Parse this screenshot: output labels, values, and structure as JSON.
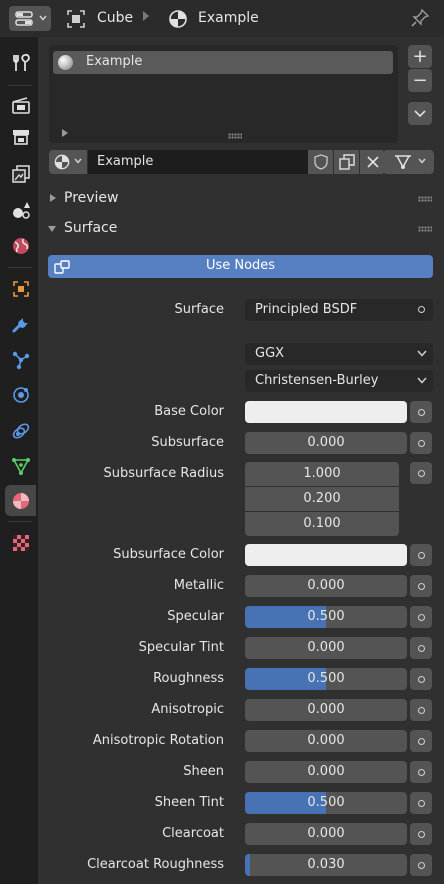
{
  "header": {
    "object_name": "Cube",
    "material_name": "Example"
  },
  "material_slots": [
    {
      "label": "Example",
      "selected": true
    }
  ],
  "material_id": {
    "name": "Example"
  },
  "panels": {
    "preview": "Preview",
    "surface": "Surface"
  },
  "use_nodes_label": "Use Nodes",
  "surface_label": "Surface",
  "surface_shader": "Principled BSDF",
  "distribution": "GGX",
  "subsurface_method": "Christensen-Burley",
  "properties": {
    "base_color": {
      "label": "Base Color",
      "color": "#eeeeee"
    },
    "subsurface": {
      "label": "Subsurface",
      "value": "0.000",
      "fraction": 0.0
    },
    "subsurface_radius": {
      "label": "Subsurface Radius",
      "values": [
        "1.000",
        "0.200",
        "0.100"
      ]
    },
    "subsurface_color": {
      "label": "Subsurface Color",
      "color": "#eeeeee"
    },
    "metallic": {
      "label": "Metallic",
      "value": "0.000",
      "fraction": 0.0
    },
    "specular": {
      "label": "Specular",
      "value": "0.500",
      "fraction": 0.5
    },
    "specular_tint": {
      "label": "Specular Tint",
      "value": "0.000",
      "fraction": 0.0
    },
    "roughness": {
      "label": "Roughness",
      "value": "0.500",
      "fraction": 0.5
    },
    "anisotropic": {
      "label": "Anisotropic",
      "value": "0.000",
      "fraction": 0.0
    },
    "anisotropic_rotation": {
      "label": "Anisotropic Rotation",
      "value": "0.000",
      "fraction": 0.0
    },
    "sheen": {
      "label": "Sheen",
      "value": "0.000",
      "fraction": 0.0
    },
    "sheen_tint": {
      "label": "Sheen Tint",
      "value": "0.500",
      "fraction": 0.5
    },
    "clearcoat": {
      "label": "Clearcoat",
      "value": "0.000",
      "fraction": 0.0
    },
    "clearcoat_roughness": {
      "label": "Clearcoat Roughness",
      "value": "0.030",
      "fraction": 0.03
    }
  },
  "colors": {
    "accent": "#4772b3",
    "use_nodes": "#5680c2",
    "panel_bg": "#303030"
  },
  "icons": {
    "tabs": [
      "tool-icon",
      "render-icon",
      "output-icon",
      "view-layer-icon",
      "scene-icon",
      "world-icon",
      "object-icon",
      "modifier-icon",
      "particles-icon",
      "physics-icon",
      "constraints-icon",
      "object-data-icon",
      "material-icon",
      "texture-icon"
    ]
  }
}
